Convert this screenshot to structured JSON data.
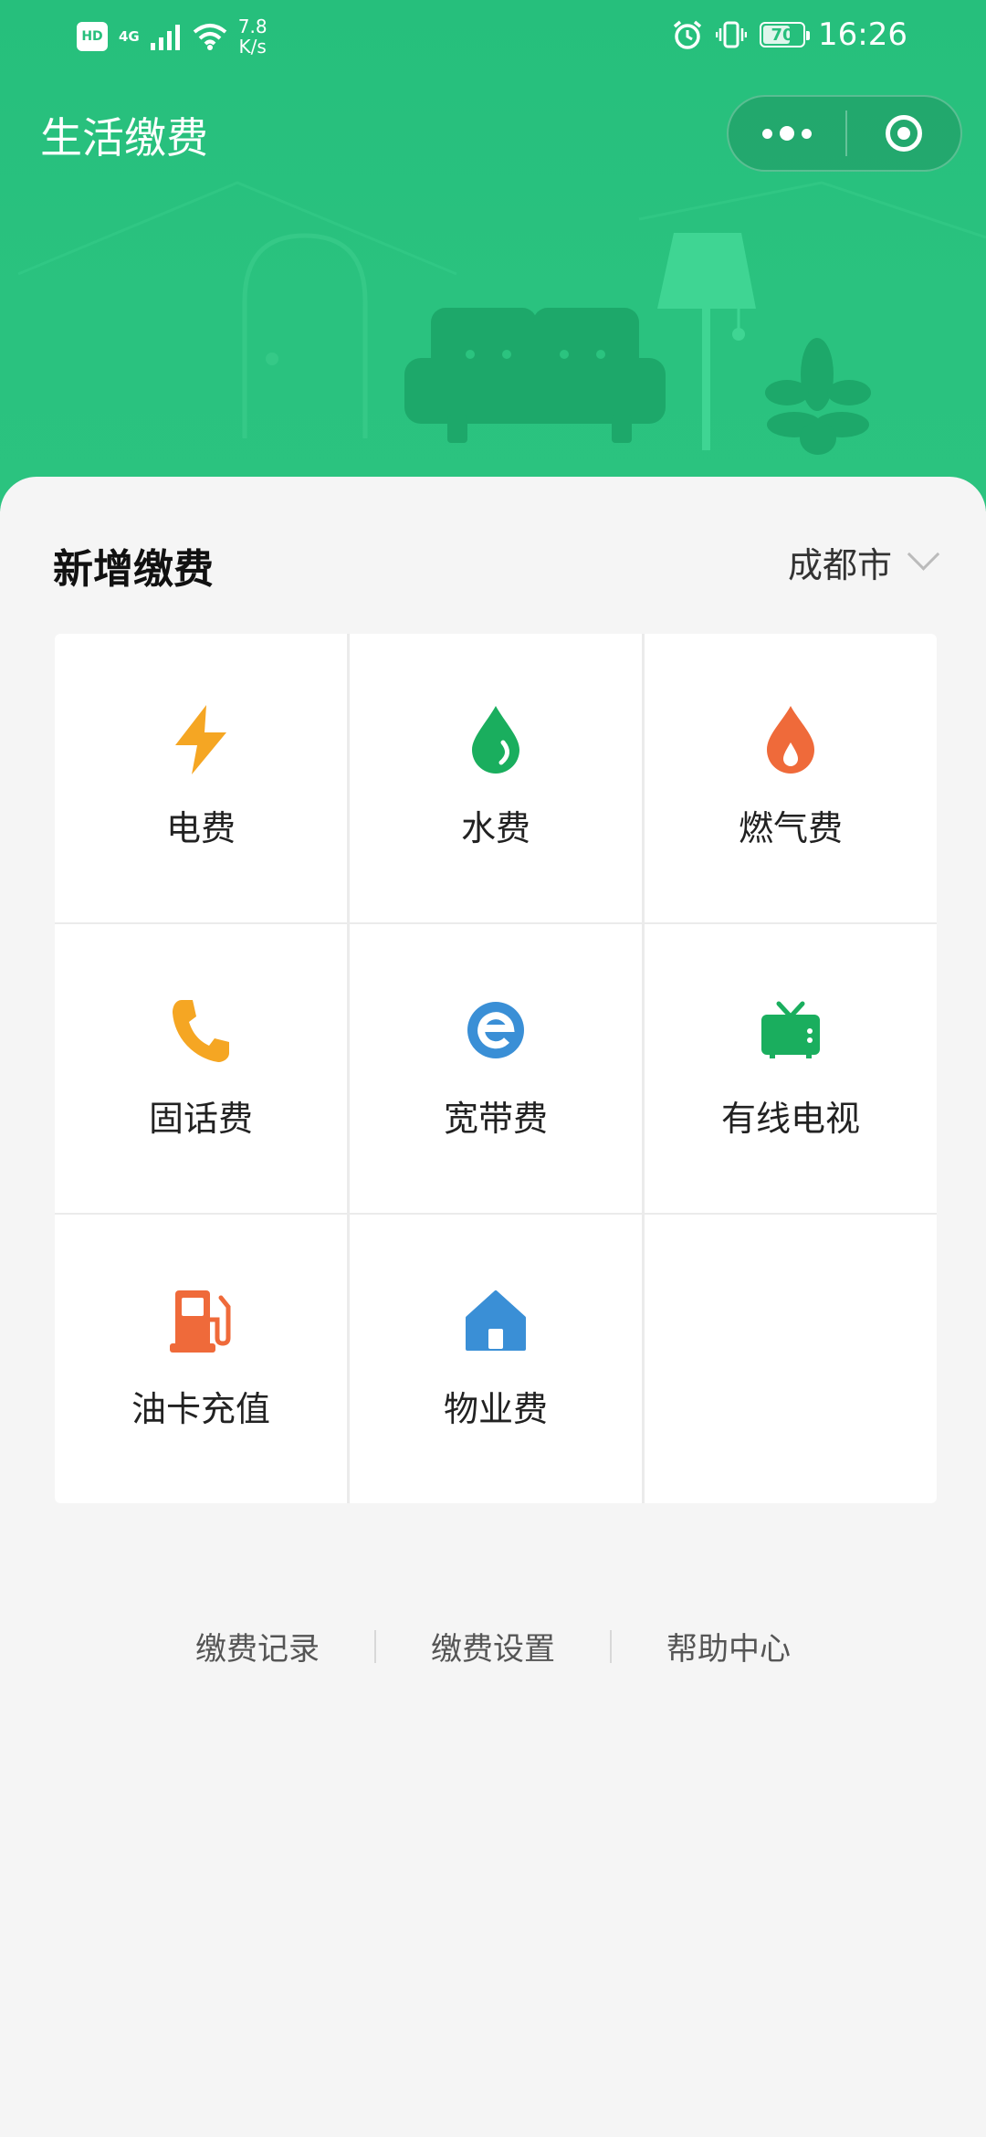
{
  "status_bar": {
    "hd": "HD",
    "network": "4G",
    "speed_value": "7.8",
    "speed_unit": "K/s",
    "battery": "70",
    "battery_level": 0.7,
    "time": "16:26"
  },
  "header": {
    "title": "生活缴费",
    "theme_color": "#26bf7c"
  },
  "section": {
    "title": "新增缴费",
    "city": "成都市"
  },
  "services": [
    {
      "label": "电费",
      "icon": "lightning-icon",
      "color": "#f5a623"
    },
    {
      "label": "水费",
      "icon": "water-drop-icon",
      "color": "#1aae5e"
    },
    {
      "label": "燃气费",
      "icon": "flame-icon",
      "color": "#ef6a3a"
    },
    {
      "label": "固话费",
      "icon": "phone-icon",
      "color": "#f5a623"
    },
    {
      "label": "宽带费",
      "icon": "broadband-e-icon",
      "color": "#3a8fd6"
    },
    {
      "label": "有线电视",
      "icon": "tv-icon",
      "color": "#1aae5e"
    },
    {
      "label": "油卡充值",
      "icon": "fuel-pump-icon",
      "color": "#ef6a3a"
    },
    {
      "label": "物业费",
      "icon": "house-icon",
      "color": "#3a8fd6"
    }
  ],
  "footer_links": [
    "缴费记录",
    "缴费设置",
    "帮助中心"
  ]
}
